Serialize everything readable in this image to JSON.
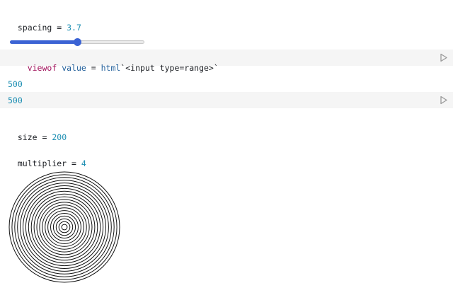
{
  "cells": {
    "spacing": {
      "name": "spacing",
      "op": " = ",
      "value": "3.7"
    },
    "slider": {
      "fraction": 0.5
    },
    "viewof": {
      "keyword": "viewof",
      "name": "value",
      "op": " = ",
      "tag": "html",
      "template": "`<input type=range>`"
    },
    "output1": {
      "value": "500"
    },
    "output2": {
      "value": "500"
    },
    "size": {
      "name": "size",
      "op": " = ",
      "value": "200"
    },
    "multiplier": {
      "name": "multiplier",
      "op": " = ",
      "value": "4"
    }
  },
  "spiral": {
    "rings": 20,
    "stroke": "#111111"
  },
  "colors": {
    "accent": "#3b63d4",
    "number": "#1e8fb3",
    "keyword": "#a0105a",
    "code_bg": "#f5f5f5"
  },
  "icons": {
    "run": "play-icon"
  }
}
